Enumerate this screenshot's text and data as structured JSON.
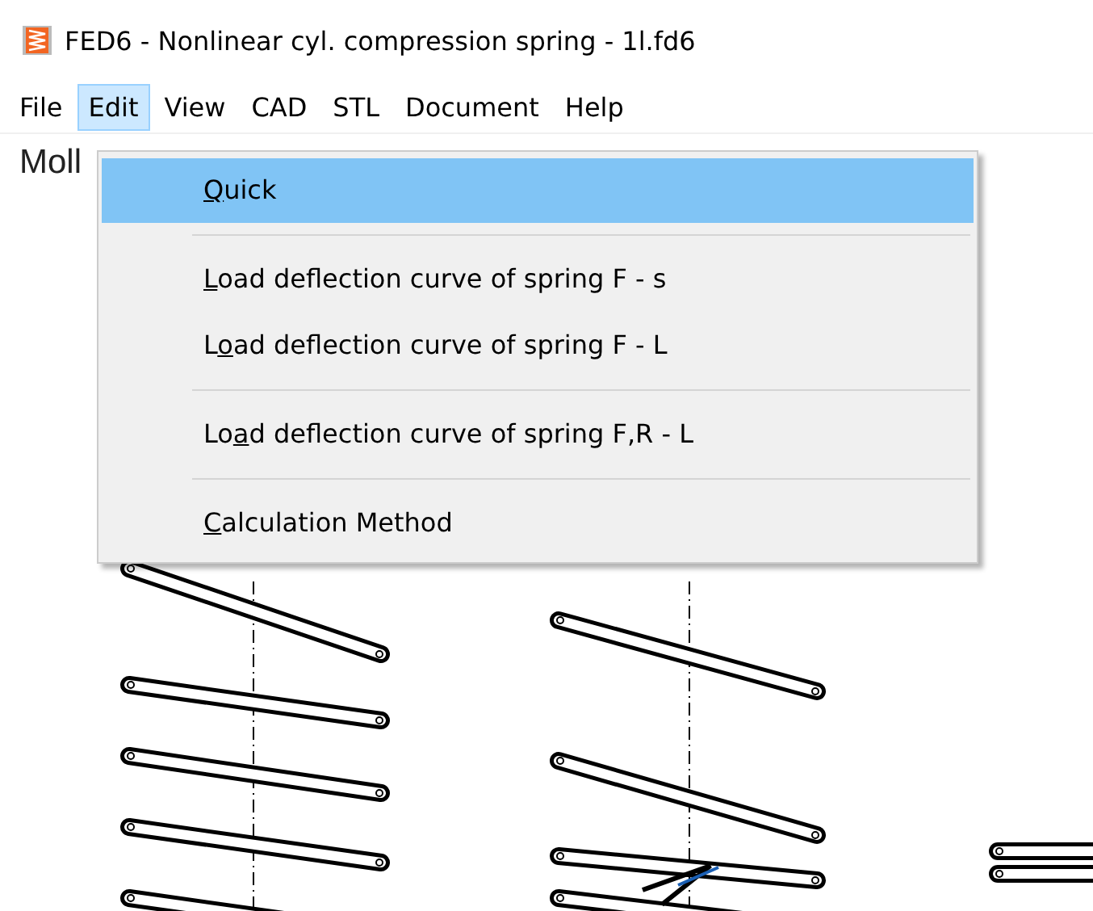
{
  "window": {
    "title": "FED6 - Nonlinear cyl. compression spring  -  1l.fd6"
  },
  "menu_bar": [
    {
      "label": "File",
      "selected": false
    },
    {
      "label": "Edit",
      "selected": true
    },
    {
      "label": "View",
      "selected": false
    },
    {
      "label": "CAD",
      "selected": false
    },
    {
      "label": "STL",
      "selected": false
    },
    {
      "label": "Document",
      "selected": false
    },
    {
      "label": "Help",
      "selected": false
    }
  ],
  "dropdown": [
    {
      "kind": "item",
      "key": "Q",
      "post": "uick",
      "selected": true
    },
    {
      "kind": "separator"
    },
    {
      "kind": "item",
      "key": "L",
      "post": "oad deflection curve of spring F - s",
      "selected": false
    },
    {
      "kind": "item",
      "pre": "L",
      "key": "o",
      "post": "ad deflection curve of spring F - L",
      "selected": false
    },
    {
      "kind": "separator"
    },
    {
      "kind": "item",
      "pre": "Lo",
      "key": "a",
      "post": "d deflection curve of spring F,R - L",
      "selected": false
    },
    {
      "kind": "separator"
    },
    {
      "kind": "item",
      "key": "C",
      "post": "alculation Method",
      "selected": false
    }
  ],
  "document": {
    "heading": "Moll"
  }
}
